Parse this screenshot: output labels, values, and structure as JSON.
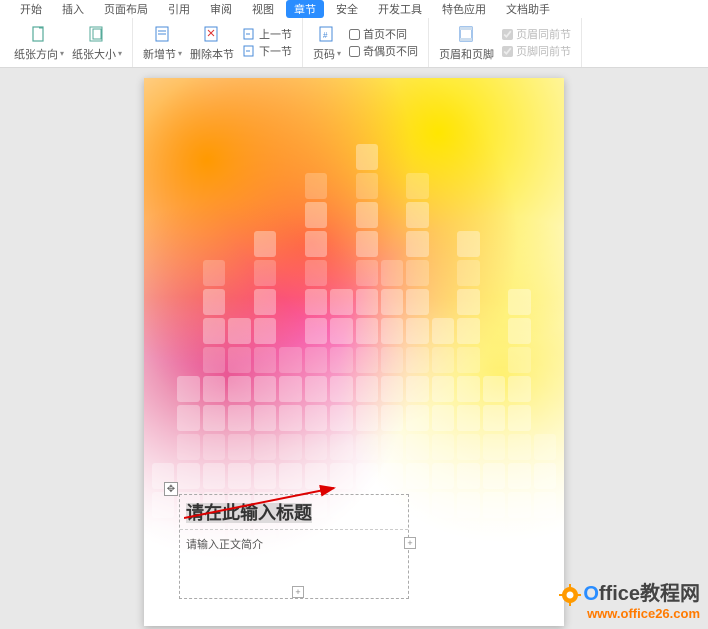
{
  "tabs": {
    "items": [
      "开始",
      "插入",
      "页面布局",
      "引用",
      "审阅",
      "视图",
      "章节",
      "安全",
      "开发工具",
      "特色应用",
      "文档助手"
    ],
    "active_index": 6
  },
  "ribbon": {
    "orientation": {
      "label": "纸张方向"
    },
    "papersize": {
      "label": "纸张大小"
    },
    "newsection": {
      "label": "新增节"
    },
    "delsection": {
      "label": "删除本节"
    },
    "prevsection": {
      "label": "上一节"
    },
    "nextsection": {
      "label": "下一节"
    },
    "pagenum": {
      "label": "页码"
    },
    "headerfooter": {
      "label": "页眉和页脚"
    },
    "firstdiff": {
      "label": "首页不同"
    },
    "oddeven": {
      "label": "奇偶页不同"
    },
    "sameheader": {
      "label": "页眉同前节"
    },
    "samefooter": {
      "label": "页脚同前节"
    }
  },
  "document": {
    "title_placeholder": "请在此输入标题",
    "body_placeholder": "请输入正文简介"
  },
  "watermark": {
    "line1_prefix": "O",
    "line1_rest": "ffice教程网",
    "line2": "www.office26.com"
  }
}
